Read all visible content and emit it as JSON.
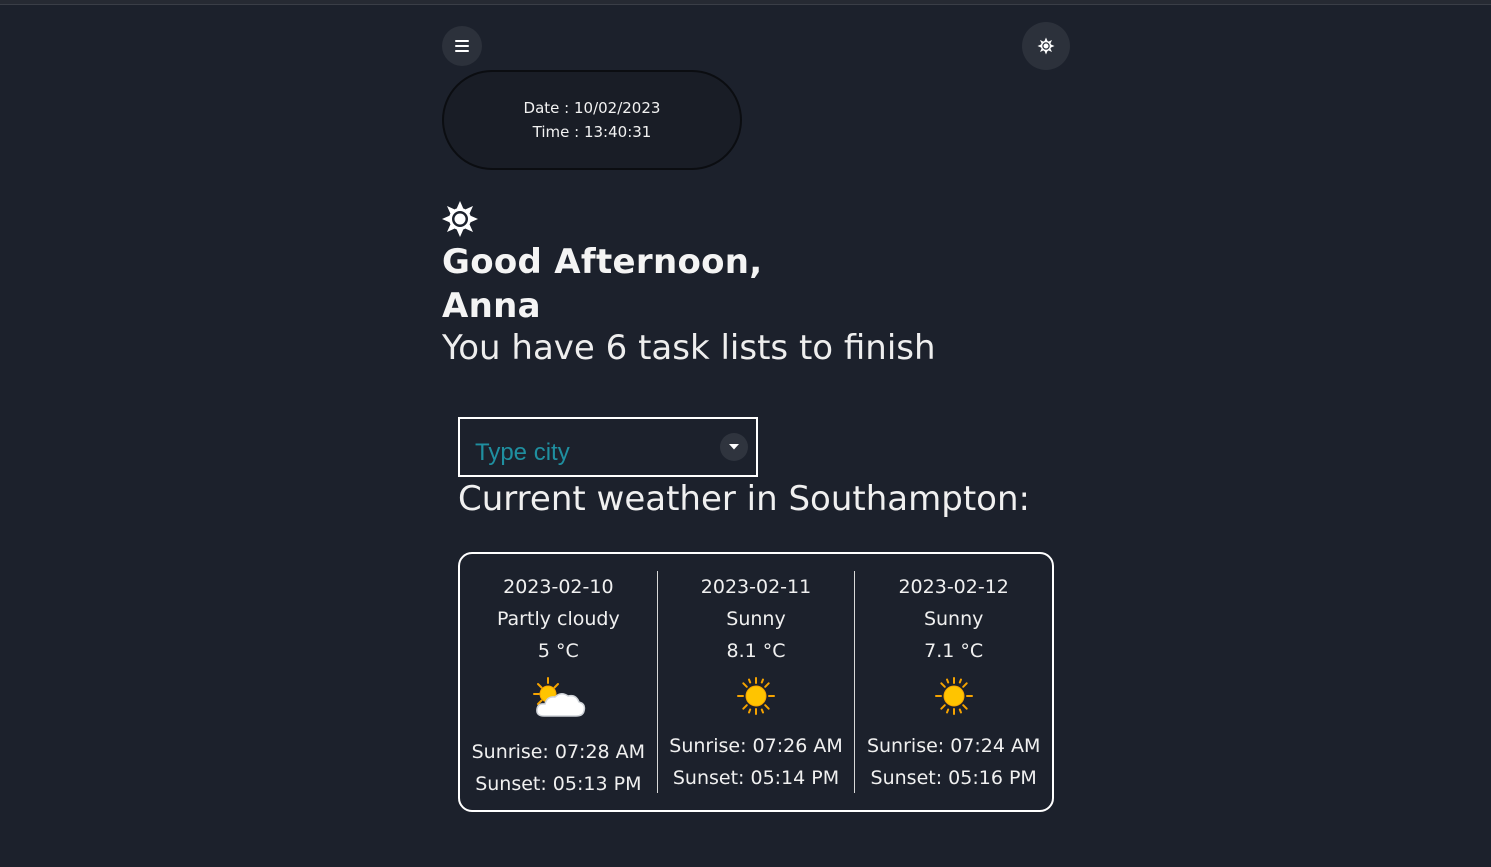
{
  "header": {
    "menu_icon": "menu-icon",
    "theme_icon": "sun-icon"
  },
  "clock": {
    "date_label": "Date : ",
    "date_value": "10/02/2023",
    "time_label": "Time : ",
    "time_value": "13:40:31"
  },
  "greeting": {
    "icon": "sun-icon",
    "line1": "Good Afternoon,",
    "name": "Anna",
    "tasks_prefix": "You have ",
    "tasks_count": "6",
    "tasks_suffix": " task lists to finish"
  },
  "city_search": {
    "placeholder": "Type city",
    "dropdown_icon": "caret-down-icon"
  },
  "weather": {
    "title_prefix": "Current weather in ",
    "city": "Southampton",
    "title_suffix": ":",
    "days": [
      {
        "date": "2023-02-10",
        "condition": "Partly cloudy",
        "temp": "5 °C",
        "icon": "partly-cloudy-icon",
        "sunrise": "Sunrise: 07:28 AM",
        "sunset": "Sunset: 05:13 PM"
      },
      {
        "date": "2023-02-11",
        "condition": "Sunny",
        "temp": "8.1 °C",
        "icon": "sunny-icon",
        "sunrise": "Sunrise: 07:26 AM",
        "sunset": "Sunset: 05:14 PM"
      },
      {
        "date": "2023-02-12",
        "condition": "Sunny",
        "temp": "7.1 °C",
        "icon": "sunny-icon",
        "sunrise": "Sunrise: 07:24 AM",
        "sunset": "Sunset: 05:16 PM"
      }
    ]
  },
  "colors": {
    "background": "#1c212c",
    "button_bg": "#2c313b",
    "placeholder": "#1f8fa0",
    "sun_yellow": "#ffc400",
    "sun_orange": "#f5a300"
  }
}
